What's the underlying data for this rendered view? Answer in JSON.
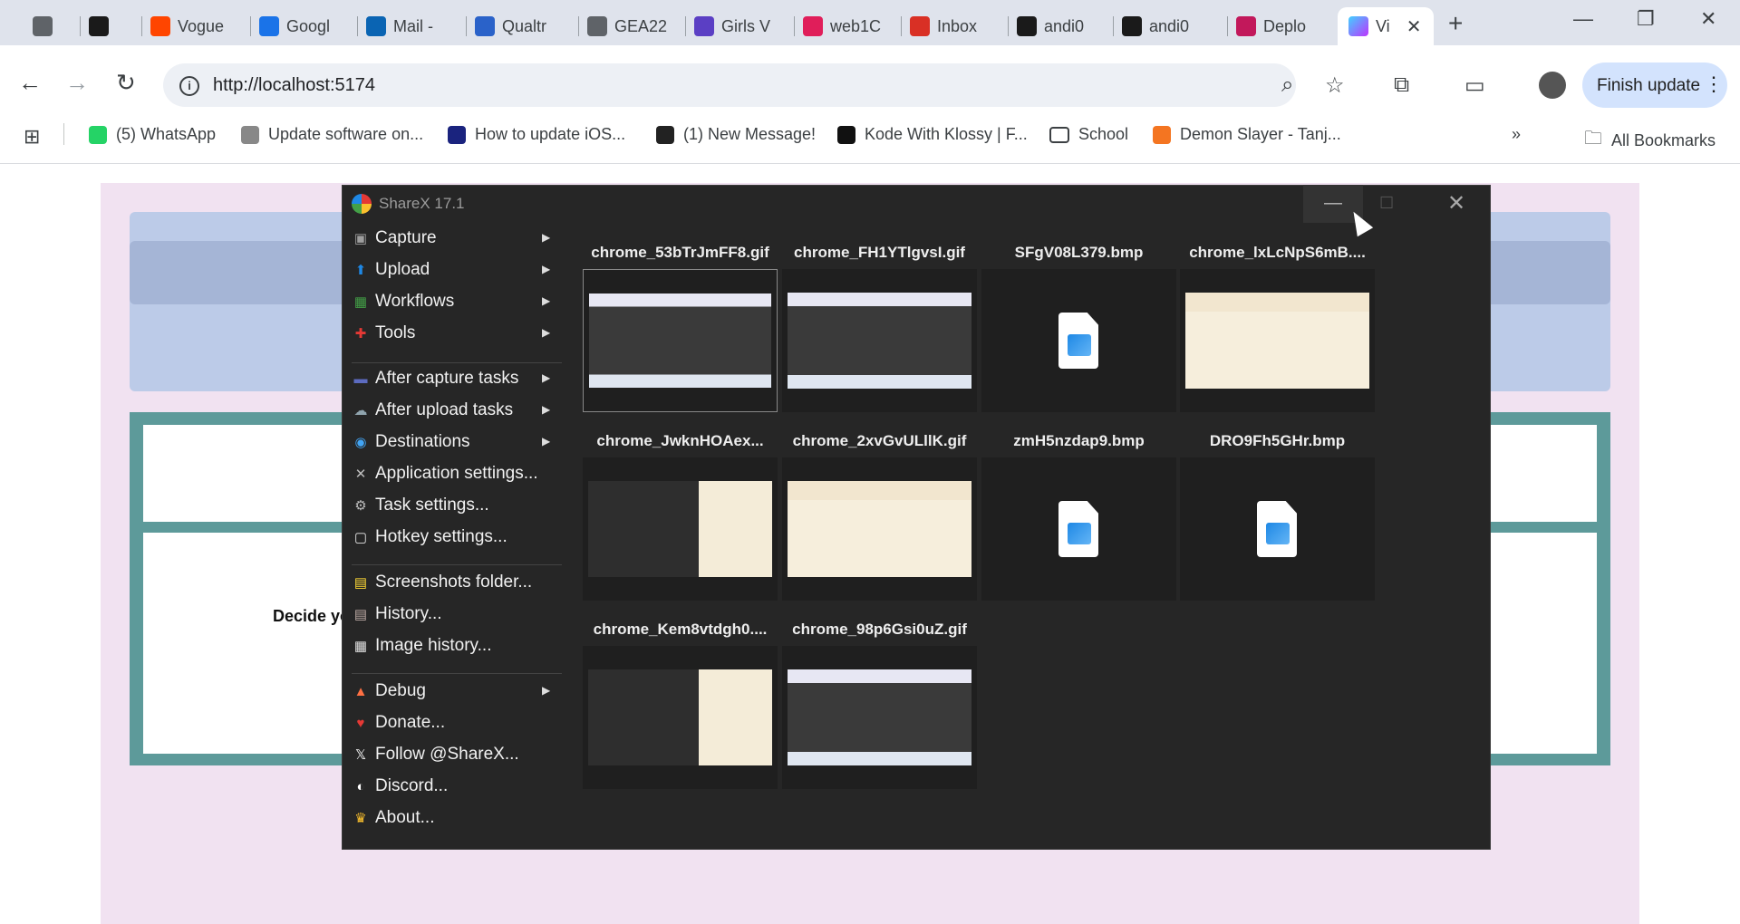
{
  "browser": {
    "tabs": [
      {
        "label": "",
        "fav": "globe-icon",
        "color": "#5f6368"
      },
      {
        "label": "",
        "fav": "shop-icon",
        "color": "#1a1a1a"
      },
      {
        "label": "Vogue",
        "fav": "reddit-icon",
        "color": "#ff4500"
      },
      {
        "label": "Googl",
        "fav": "calendar-icon",
        "color": "#1a73e8"
      },
      {
        "label": "Mail -",
        "fav": "outlook-icon",
        "color": "#0a64b3"
      },
      {
        "label": "Qualtr",
        "fav": "qualtrics-icon",
        "color": "#2a62c9"
      },
      {
        "label": "GEA22",
        "fav": "globe-icon",
        "color": "#5f6368"
      },
      {
        "label": "Girls V",
        "fav": "list-icon",
        "color": "#5b3fc4"
      },
      {
        "label": "web1C",
        "fav": "slack-icon",
        "color": "#e01e5a"
      },
      {
        "label": "Inbox",
        "fav": "gmail-icon",
        "color": "#d93025"
      },
      {
        "label": "andi0",
        "fav": "github-icon",
        "color": "#1a1a1a"
      },
      {
        "label": "andi0",
        "fav": "github-icon",
        "color": "#1a1a1a"
      },
      {
        "label": "Deplo",
        "fav": "deploy-icon",
        "color": "#c2185b"
      }
    ],
    "active_tab": {
      "label": "Vi",
      "fav": "vite-icon"
    },
    "url": "http://localhost:5174",
    "finish_update": "Finish update",
    "bookmarks": [
      {
        "label": "(5) WhatsApp",
        "icon": "whatsapp-icon",
        "color": "#25d366"
      },
      {
        "label": "Update software on...",
        "icon": "apple-icon",
        "color": "#888888"
      },
      {
        "label": "How to update iOS...",
        "icon": "medium-icon",
        "color": "#1a237e"
      },
      {
        "label": "(1) New Message!",
        "icon": "message-icon",
        "color": "#222222"
      },
      {
        "label": "Kode With Klossy | F...",
        "icon": "kode-icon",
        "color": "#111111"
      },
      {
        "label": "School",
        "icon": "folder-icon",
        "color": "#ffffff"
      },
      {
        "label": "Demon Slayer - Tanj...",
        "icon": "crunchyroll-icon",
        "color": "#f47521"
      }
    ],
    "all_bookmarks": "All Bookmarks"
  },
  "page": {
    "decide_text": "Decide yo"
  },
  "sharex": {
    "title": "ShareX 17.1",
    "menu": [
      {
        "label": "Capture",
        "icon": "capture-icon",
        "arrow": true
      },
      {
        "label": "Upload",
        "icon": "upload-icon",
        "arrow": true
      },
      {
        "label": "Workflows",
        "icon": "workflows-icon",
        "arrow": true
      },
      {
        "label": "Tools",
        "icon": "tools-icon",
        "arrow": true
      },
      {
        "label": "After capture tasks",
        "icon": "after-capture-icon",
        "arrow": true
      },
      {
        "label": "After upload tasks",
        "icon": "after-upload-icon",
        "arrow": true
      },
      {
        "label": "Destinations",
        "icon": "destinations-icon",
        "arrow": true
      },
      {
        "label": "Application settings...",
        "icon": "app-settings-icon",
        "arrow": false
      },
      {
        "label": "Task settings...",
        "icon": "task-settings-icon",
        "arrow": false
      },
      {
        "label": "Hotkey settings...",
        "icon": "hotkey-settings-icon",
        "arrow": false
      },
      {
        "label": "Screenshots folder...",
        "icon": "folder-icon",
        "arrow": false
      },
      {
        "label": "History...",
        "icon": "history-icon",
        "arrow": false
      },
      {
        "label": "Image history...",
        "icon": "image-history-icon",
        "arrow": false
      },
      {
        "label": "Debug",
        "icon": "debug-icon",
        "arrow": true
      },
      {
        "label": "Donate...",
        "icon": "heart-icon",
        "arrow": false
      },
      {
        "label": "Follow @ShareX...",
        "icon": "x-icon",
        "arrow": false
      },
      {
        "label": "Discord...",
        "icon": "discord-icon",
        "arrow": false
      },
      {
        "label": "About...",
        "icon": "crown-icon",
        "arrow": false
      }
    ],
    "files": [
      {
        "name": "chrome_53bTrJmFF8.gif",
        "kind": "gif",
        "selected": true
      },
      {
        "name": "chrome_FH1YTlgvsI.gif",
        "kind": "gif",
        "selected": false
      },
      {
        "name": "SFgV08L379.bmp",
        "kind": "bmp",
        "selected": false
      },
      {
        "name": "chrome_lxLcNpS6mB....",
        "kind": "gif-light",
        "selected": false
      },
      {
        "name": "chrome_JwknHOAex...",
        "kind": "gif-mixed",
        "selected": false
      },
      {
        "name": "chrome_2xvGvULllK.gif",
        "kind": "gif-light",
        "selected": false
      },
      {
        "name": "zmH5nzdap9.bmp",
        "kind": "bmp",
        "selected": false
      },
      {
        "name": "DRO9Fh5GHr.bmp",
        "kind": "bmp",
        "selected": false
      },
      {
        "name": "chrome_Kem8vtdgh0....",
        "kind": "gif-mixed",
        "selected": false
      },
      {
        "name": "chrome_98p6Gsi0uZ.gif",
        "kind": "gif",
        "selected": false
      }
    ]
  }
}
